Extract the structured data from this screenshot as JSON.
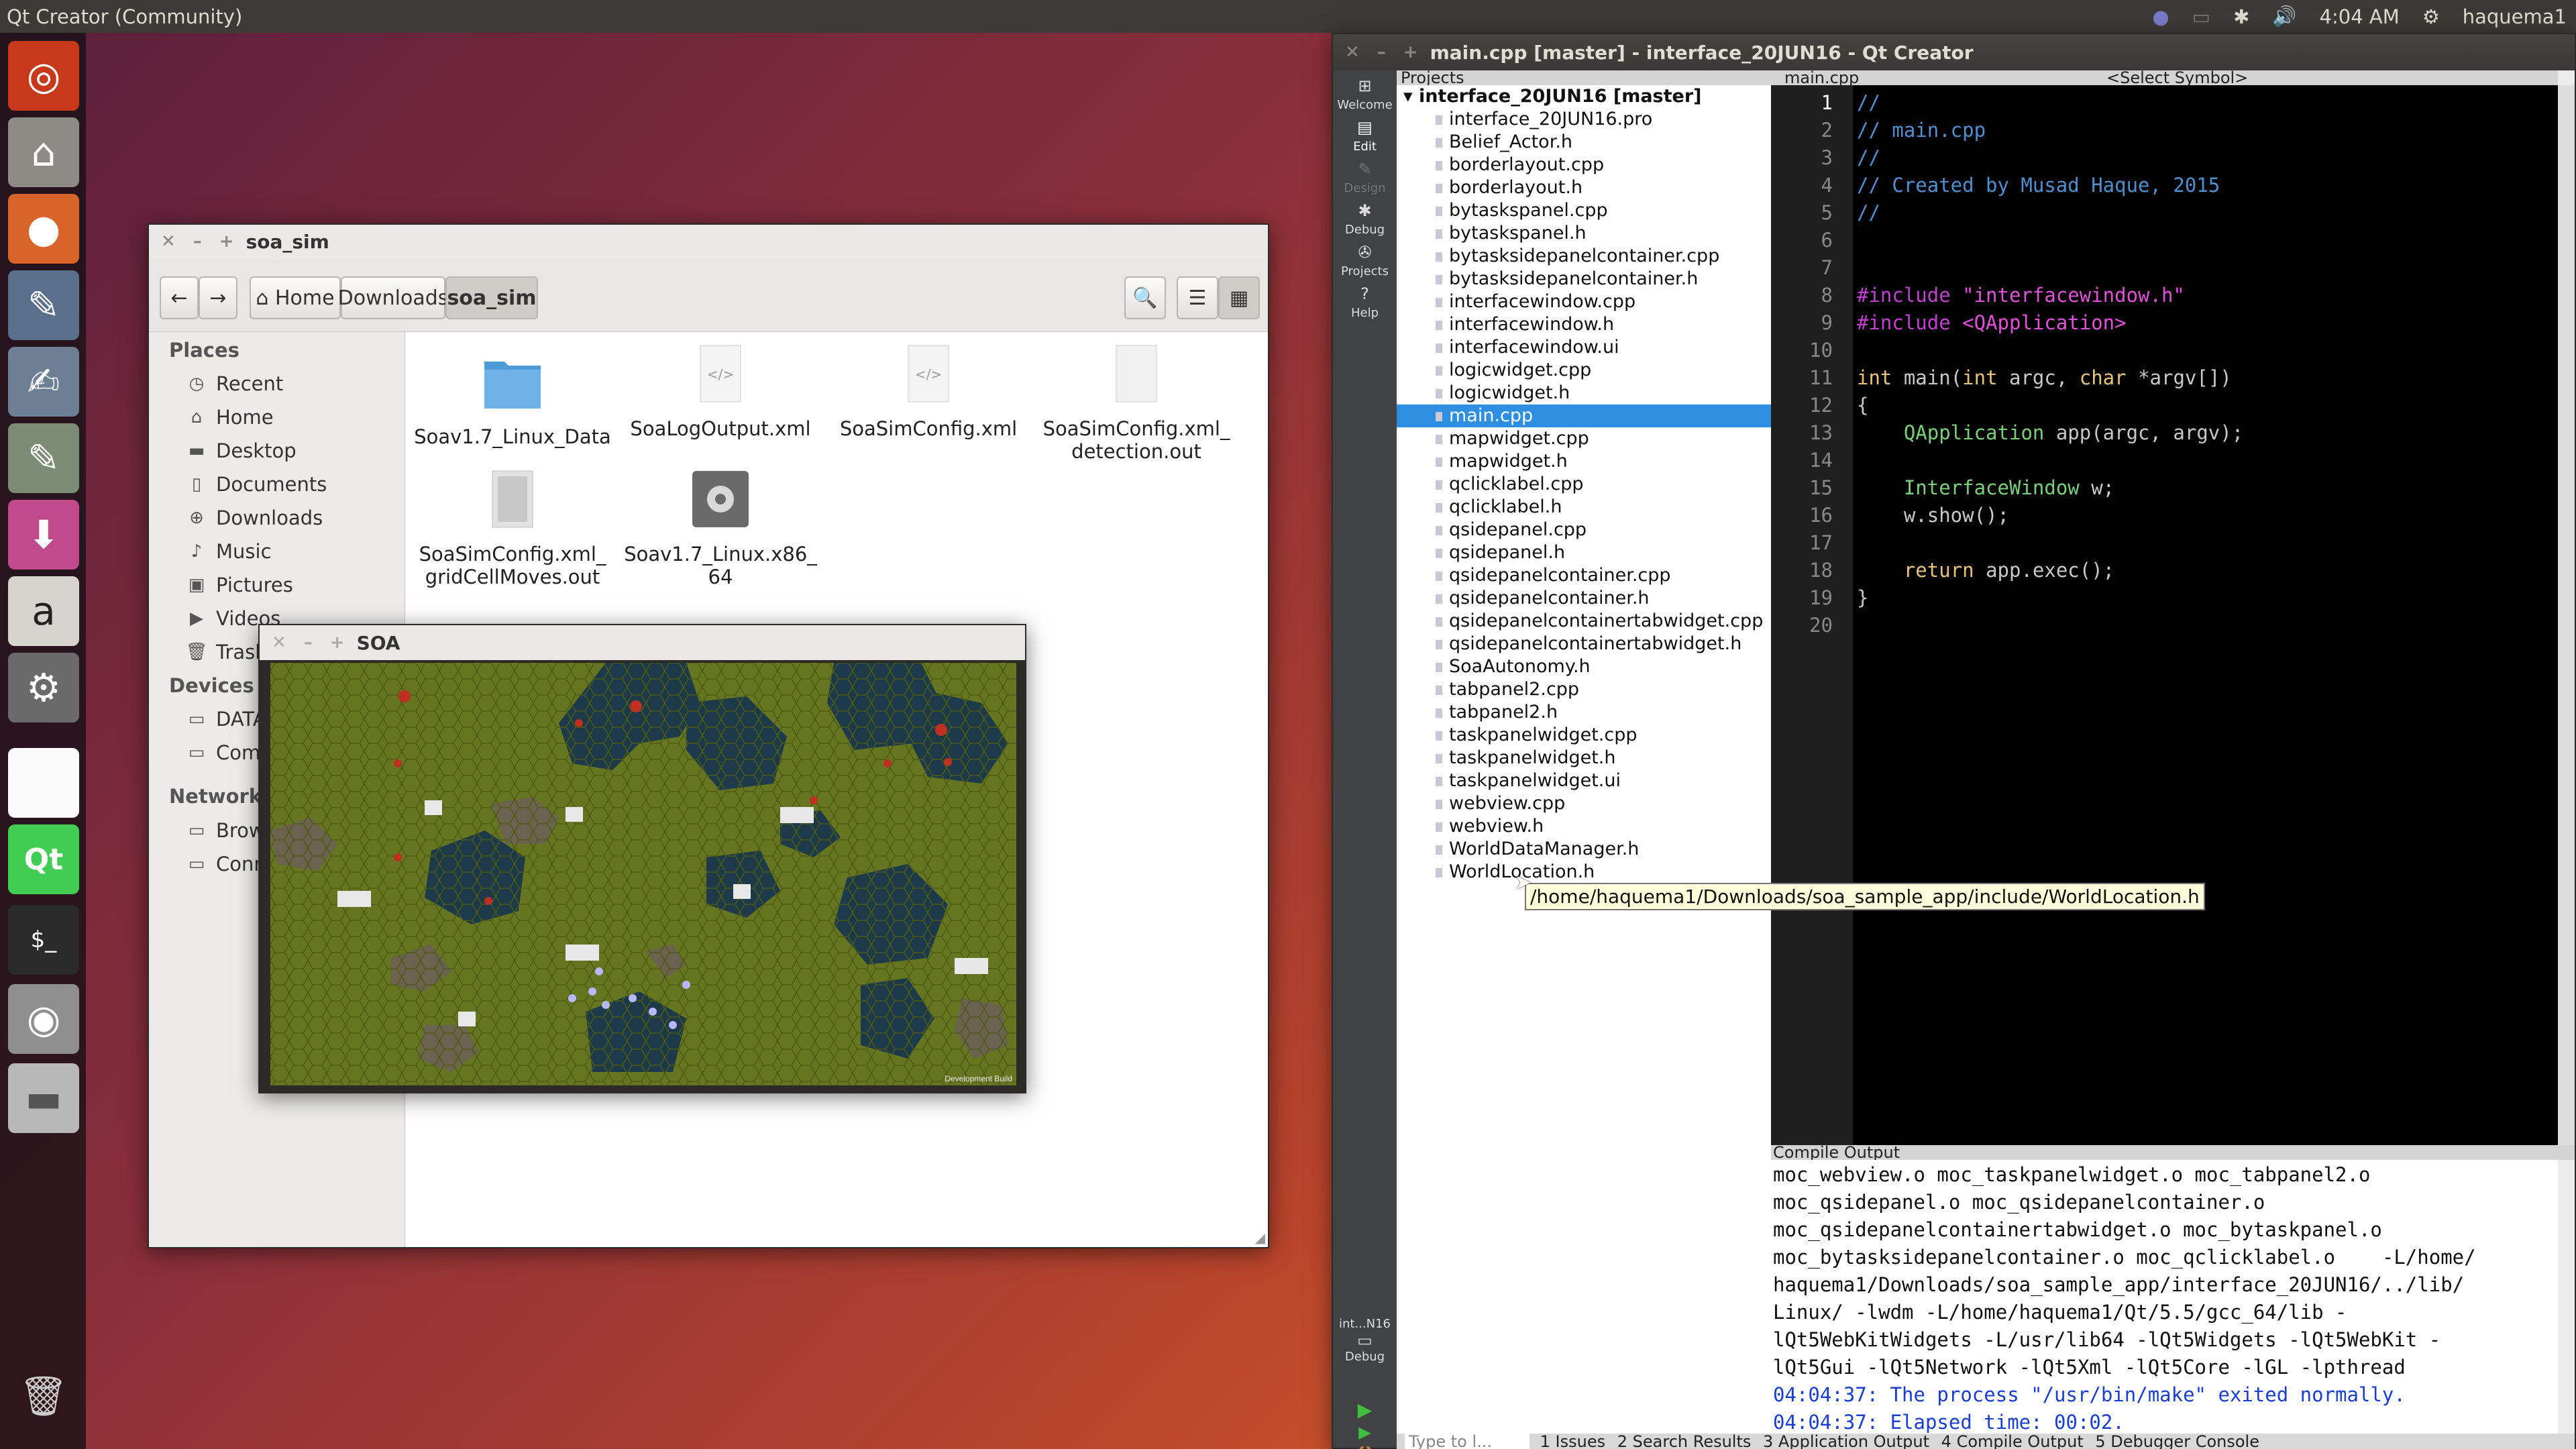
{
  "topbar": {
    "title": "Qt Creator (Community)",
    "time": "4:04 AM",
    "user": "haquema1"
  },
  "launcher": {
    "items": [
      "ubuntu-dash-icon",
      "home-folder-icon",
      "firefox-icon",
      "libreoffice-writer-icon",
      "text-editor-icon",
      "gedit-icon",
      "software-updater-icon",
      "amazon-icon",
      "system-settings-icon",
      "blank-window-icon",
      "qt-creator-icon",
      "terminal-icon",
      "camera-icon",
      "disk-icon",
      "trash-icon"
    ]
  },
  "files": {
    "title": "soa_sim",
    "breadcrumb": {
      "home": "Home",
      "downloads": "Downloads",
      "current": "soa_sim"
    },
    "places_header": "Places",
    "places": [
      "Recent",
      "Home",
      "Desktop",
      "Documents",
      "Downloads",
      "Music",
      "Pictures",
      "Videos",
      "Trash"
    ],
    "devices_header": "Devices",
    "devices": [
      "DATA",
      "Comp"
    ],
    "network_header": "Network",
    "network": [
      "Brows",
      "Conn"
    ],
    "items": [
      {
        "name": "Soav1.7_Linux_Data",
        "icon": "folder"
      },
      {
        "name": "SoaLogOutput.xml",
        "icon": "xml"
      },
      {
        "name": "SoaSimConfig.xml",
        "icon": "xml"
      },
      {
        "name": "SoaSimConfig.xml_\ndetection.out",
        "icon": "blank"
      },
      {
        "name": "SoaSimConfig.xml_\ngridCellMoves.out",
        "icon": "grid"
      },
      {
        "name": "Soav1.7_Linux.x86_\n64",
        "icon": "exec"
      }
    ]
  },
  "soa": {
    "title": "SOA",
    "watermark": "Development Build"
  },
  "qt": {
    "title": "main.cpp [master] - interface_20JUN16 - Qt Creator",
    "modes": [
      "Welcome",
      "Edit",
      "Design",
      "Debug",
      "Projects",
      "Help"
    ],
    "kit": "int...N16",
    "kit_mode": "Debug",
    "projects_label": "Projects",
    "editor_file": "main.cpp",
    "symbol": "<Select Symbol>",
    "project_root": "interface_20JUN16 [master]",
    "files": [
      "interface_20JUN16.pro",
      "Belief_Actor.h",
      "borderlayout.cpp",
      "borderlayout.h",
      "bytaskspanel.cpp",
      "bytaskspanel.h",
      "bytasksidepanelcontainer.cpp",
      "bytasksidepanelcontainer.h",
      "interfacewindow.cpp",
      "interfacewindow.h",
      "interfacewindow.ui",
      "logicwidget.cpp",
      "logicwidget.h",
      "main.cpp",
      "mapwidget.cpp",
      "mapwidget.h",
      "qclicklabel.cpp",
      "qclicklabel.h",
      "qsidepanel.cpp",
      "qsidepanel.h",
      "qsidepanelcontainer.cpp",
      "qsidepanelcontainer.h",
      "qsidepanelcontainertabwidget.cpp",
      "qsidepanelcontainertabwidget.h",
      "SoaAutonomy.h",
      "tabpanel2.cpp",
      "tabpanel2.h",
      "taskpanelwidget.cpp",
      "taskpanelwidget.h",
      "taskpanelwidget.ui",
      "webview.cpp",
      "webview.h",
      "WorldDataManager.h",
      "WorldLocation.h"
    ],
    "selected_file": "main.cpp",
    "tooltip": "/home/haquema1/Downloads/soa_sample_app/include/WorldLocation.h",
    "code": [
      [
        {
          "t": "//",
          "c": "cm"
        }
      ],
      [
        {
          "t": "// main.cpp",
          "c": "cm"
        }
      ],
      [
        {
          "t": "//",
          "c": "cm"
        }
      ],
      [
        {
          "t": "// Created by Musad Haque, 2015",
          "c": "cm"
        }
      ],
      [
        {
          "t": "//",
          "c": "cm"
        }
      ],
      [],
      [],
      [
        {
          "t": "#include ",
          "c": "pp"
        },
        {
          "t": "\"interfacewindow.h\"",
          "c": "str"
        }
      ],
      [
        {
          "t": "#include ",
          "c": "pp"
        },
        {
          "t": "<QApplication>",
          "c": "str"
        }
      ],
      [],
      [
        {
          "t": "int",
          "c": "kw"
        },
        {
          "t": " main(",
          "c": "pl"
        },
        {
          "t": "int",
          "c": "kw"
        },
        {
          "t": " argc, ",
          "c": "pl"
        },
        {
          "t": "char",
          "c": "kw"
        },
        {
          "t": " *argv[])",
          "c": "pl"
        }
      ],
      [
        {
          "t": "{",
          "c": "pl"
        }
      ],
      [
        {
          "t": "    ",
          "c": "pl"
        },
        {
          "t": "QApplication",
          "c": "ty"
        },
        {
          "t": " app(argc, argv);",
          "c": "pl"
        }
      ],
      [],
      [
        {
          "t": "    ",
          "c": "pl"
        },
        {
          "t": "InterfaceWindow",
          "c": "ty"
        },
        {
          "t": " w;",
          "c": "pl"
        }
      ],
      [
        {
          "t": "    w.show();",
          "c": "pl"
        }
      ],
      [],
      [
        {
          "t": "    ",
          "c": "pl"
        },
        {
          "t": "return",
          "c": "kw"
        },
        {
          "t": " app.exec();",
          "c": "pl"
        }
      ],
      [
        {
          "t": "}",
          "c": "pl"
        }
      ],
      []
    ],
    "output_label": "Compile Output",
    "output": [
      {
        "t": "moc_webview.o moc_taskpanelwidget.o moc_tabpanel2.o",
        "c": "n"
      },
      {
        "t": "moc_qsidepanel.o moc_qsidepanelcontainer.o",
        "c": "n"
      },
      {
        "t": "moc_qsidepanelcontainertabwidget.o moc_bytaskpanel.o",
        "c": "n"
      },
      {
        "t": "moc_bytasksidepanelcontainer.o moc_qclicklabel.o    -L/home/",
        "c": "n"
      },
      {
        "t": "haquema1/Downloads/soa_sample_app/interface_20JUN16/../lib/",
        "c": "n"
      },
      {
        "t": "Linux/ -lwdm -L/home/haquema1/Qt/5.5/gcc_64/lib -",
        "c": "n"
      },
      {
        "t": "lQt5WebKitWidgets -L/usr/lib64 -lQt5Widgets -lQt5WebKit -",
        "c": "n"
      },
      {
        "t": "lQt5Gui -lQt5Network -lQt5Xml -lQt5Core -lGL -lpthread",
        "c": "n"
      },
      {
        "t": "04:04:37: The process \"/usr/bin/make\" exited normally.",
        "c": "b"
      },
      {
        "t": "04:04:37: Elapsed time: 00:02.",
        "c": "b"
      }
    ],
    "status_search": "Type to l...",
    "panes": [
      "1 Issues",
      "2 Search Results",
      "3 Application Output",
      "4 Compile Output",
      "5 Debugger Console"
    ]
  },
  "colors": {
    "comment": "#4f8fd0",
    "preproc": "#c040d0",
    "string": "#e050d8",
    "keyword": "#e6c27a",
    "type": "#7ad07a",
    "plain": "#c8c8c8",
    "output_blue": "#1a3fd0",
    "selection": "#2e8fe0"
  }
}
